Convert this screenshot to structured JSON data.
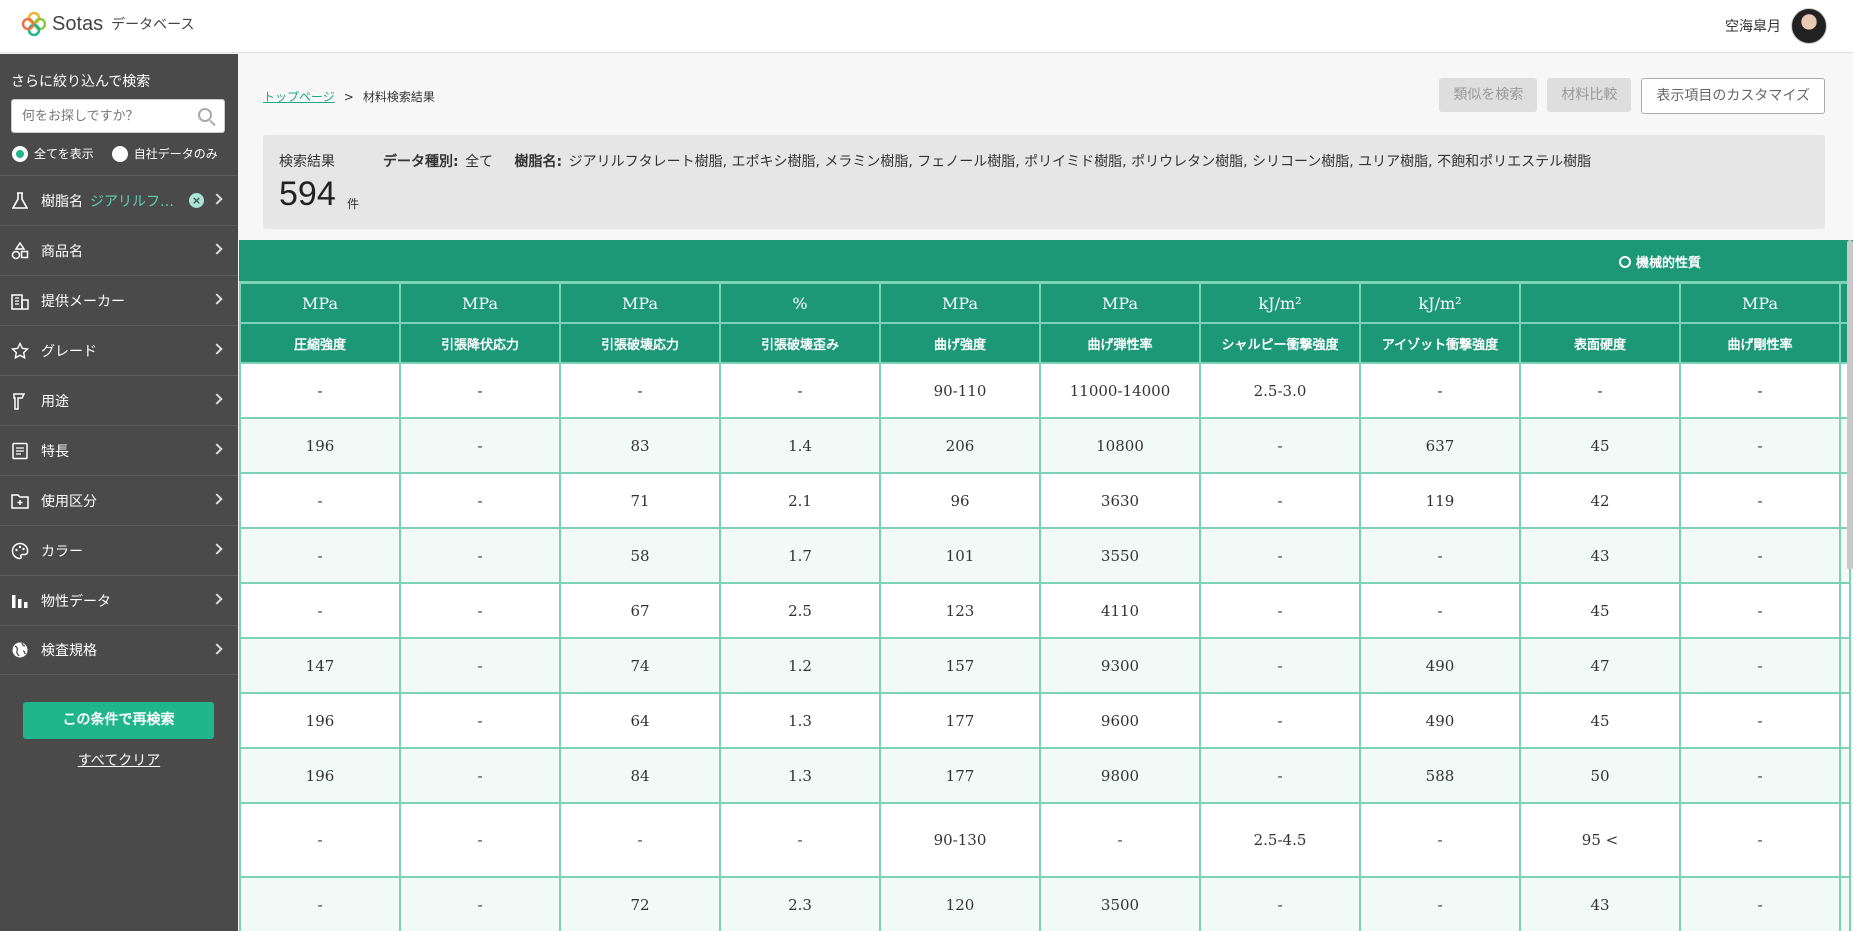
{
  "header": {
    "logo_text": "Sotas",
    "logo_sub": "データベース",
    "user_name": "空海皐月"
  },
  "sidebar": {
    "title": "さらに絞り込んで検索",
    "search_placeholder": "何をお探しですか？",
    "radio_all": "全てを表示",
    "radio_own": "自社データのみ",
    "items": [
      {
        "label": "樹脂名",
        "value": "ジアリルフ…",
        "icon": "flask-icon"
      },
      {
        "label": "商品名",
        "icon": "shapes-icon"
      },
      {
        "label": "提供メーカー",
        "icon": "building-icon"
      },
      {
        "label": "グレード",
        "icon": "star-icon"
      },
      {
        "label": "用途",
        "icon": "tool-icon"
      },
      {
        "label": "特長",
        "icon": "document-icon"
      },
      {
        "label": "使用区分",
        "icon": "folder-icon"
      },
      {
        "label": "カラー",
        "icon": "palette-icon"
      },
      {
        "label": "物性データ",
        "icon": "bar-chart-icon"
      },
      {
        "label": "検査規格",
        "icon": "globe-icon"
      }
    ],
    "research_button": "この条件で再検索",
    "clear_all": "すべてクリア"
  },
  "breadcrumb": {
    "top": "トップページ",
    "separator": ">",
    "current": "材料検索結果"
  },
  "actions": {
    "similar": "類似を検索",
    "compare": "材料比較",
    "customize": "表示項目のカスタマイズ"
  },
  "summary": {
    "label": "検索結果",
    "count": "594",
    "unit": "件",
    "data_type_label": "データ種別:",
    "data_type_value": "全て",
    "resin_label": "樹脂名:",
    "resin_value": "ジアリルフタレート樹脂, エポキシ樹脂, メラミン樹脂, フェノール樹脂, ポリイミド樹脂, ポリウレタン樹脂, シリコーン樹脂, ユリア樹脂, 不飽和ポリエステル樹脂"
  },
  "table": {
    "group_label": "機械的性質",
    "units": [
      "MPa",
      "MPa",
      "MPa",
      "%",
      "MPa",
      "MPa",
      "kJ/m²",
      "kJ/m²",
      "",
      "MPa"
    ],
    "columns": [
      "圧縮強度",
      "引張降伏応力",
      "引張破壊応力",
      "引張破壊歪み",
      "曲げ強度",
      "曲げ弾性率",
      "シャルピー衝撃強度",
      "アイゾット衝撃強度",
      "表面硬度",
      "曲げ剛性率"
    ],
    "rows": [
      [
        "-",
        "-",
        "-",
        "-",
        "90-110",
        "11000-14000",
        "2.5-3.0",
        "-",
        "-",
        "-"
      ],
      [
        "196",
        "-",
        "83",
        "1.4",
        "206",
        "10800",
        "-",
        "637",
        "45",
        "-"
      ],
      [
        "-",
        "-",
        "71",
        "2.1",
        "96",
        "3630",
        "-",
        "119",
        "42",
        "-"
      ],
      [
        "-",
        "-",
        "58",
        "1.7",
        "101",
        "3550",
        "-",
        "-",
        "43",
        "-"
      ],
      [
        "-",
        "-",
        "67",
        "2.5",
        "123",
        "4110",
        "-",
        "-",
        "45",
        "-"
      ],
      [
        "147",
        "-",
        "74",
        "1.2",
        "157",
        "9300",
        "-",
        "490",
        "47",
        "-"
      ],
      [
        "196",
        "-",
        "64",
        "1.3",
        "177",
        "9600",
        "-",
        "490",
        "45",
        "-"
      ],
      [
        "196",
        "-",
        "84",
        "1.3",
        "177",
        "9800",
        "-",
        "588",
        "50",
        "-"
      ],
      [
        "-",
        "-",
        "-",
        "-",
        "90-130",
        "-",
        "2.5-4.5",
        "-",
        "95 <",
        "-"
      ],
      [
        "-",
        "-",
        "72",
        "2.3",
        "120",
        "3500",
        "-",
        "-",
        "43",
        "-"
      ]
    ]
  },
  "colors": {
    "accent": "#20b58b",
    "table_header": "#1d9877",
    "sidebar_bg": "#4a4a4a"
  }
}
